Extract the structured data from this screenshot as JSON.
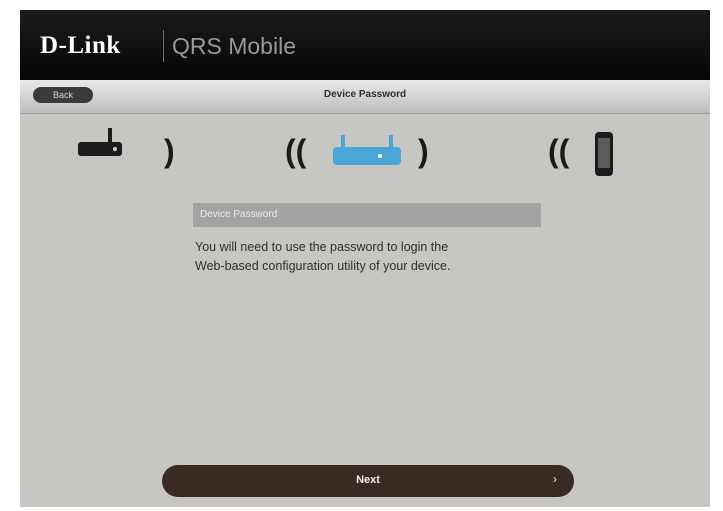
{
  "header": {
    "brand": "D-Link",
    "app_title": "QRS Mobile"
  },
  "navbar": {
    "back_label": "Back",
    "title": "Device Password"
  },
  "illustration": {
    "devices": [
      "modem-icon",
      "router-icon",
      "phone-icon"
    ],
    "waves": {
      "right": ")",
      "left": "(("
    }
  },
  "content": {
    "section_label": "Device Password",
    "line1": "You will need to use the password to login the",
    "line2": "Web-based configuration utility of your device."
  },
  "footer": {
    "next_label": "Next",
    "next_arrow": "›"
  },
  "colors": {
    "header_bg": "#0c0c0c",
    "content_bg": "#c8c6c2",
    "router_accent": "#4aa6d6",
    "next_button": "#3a2a24"
  }
}
